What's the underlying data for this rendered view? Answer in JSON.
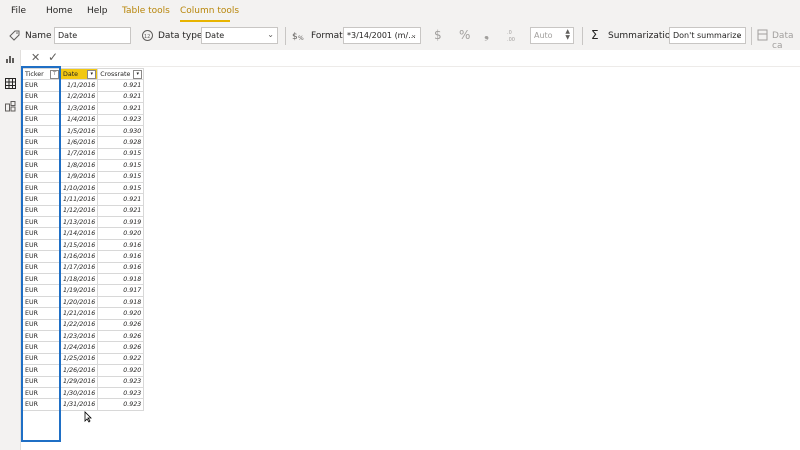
{
  "tabs": [
    {
      "label": "File"
    },
    {
      "label": "Home"
    },
    {
      "label": "Help"
    },
    {
      "label": "Table tools"
    },
    {
      "label": "Column tools"
    }
  ],
  "ribbon": {
    "name_label": "Name",
    "name_value": "Date",
    "datatype_label": "Data type",
    "datatype_value": "Date",
    "format_label": "Format",
    "format_value": "*3/14/2001 (m/...",
    "currency_symbol": "$",
    "percent_symbol": "%",
    "comma_symbol": "❟",
    "decimal_value": "Auto",
    "summarization_label": "Summarization",
    "summarization_value": "Don't summarize",
    "datacat_label": "Data ca"
  },
  "formula_bar": {
    "cancel": "✕",
    "commit": "✓"
  },
  "table": {
    "headers": [
      "Ticker",
      "Date",
      "Crossrate"
    ],
    "rows": [
      [
        "EUR",
        "1/1/2016",
        "0.921"
      ],
      [
        "EUR",
        "1/2/2016",
        "0.921"
      ],
      [
        "EUR",
        "1/3/2016",
        "0.921"
      ],
      [
        "EUR",
        "1/4/2016",
        "0.923"
      ],
      [
        "EUR",
        "1/5/2016",
        "0.930"
      ],
      [
        "EUR",
        "1/6/2016",
        "0.928"
      ],
      [
        "EUR",
        "1/7/2016",
        "0.915"
      ],
      [
        "EUR",
        "1/8/2016",
        "0.915"
      ],
      [
        "EUR",
        "1/9/2016",
        "0.915"
      ],
      [
        "EUR",
        "1/10/2016",
        "0.915"
      ],
      [
        "EUR",
        "1/11/2016",
        "0.921"
      ],
      [
        "EUR",
        "1/12/2016",
        "0.921"
      ],
      [
        "EUR",
        "1/13/2016",
        "0.919"
      ],
      [
        "EUR",
        "1/14/2016",
        "0.920"
      ],
      [
        "EUR",
        "1/15/2016",
        "0.916"
      ],
      [
        "EUR",
        "1/16/2016",
        "0.916"
      ],
      [
        "EUR",
        "1/17/2016",
        "0.916"
      ],
      [
        "EUR",
        "1/18/2016",
        "0.918"
      ],
      [
        "EUR",
        "1/19/2016",
        "0.917"
      ],
      [
        "EUR",
        "1/20/2016",
        "0.918"
      ],
      [
        "EUR",
        "1/21/2016",
        "0.920"
      ],
      [
        "EUR",
        "1/22/2016",
        "0.926"
      ],
      [
        "EUR",
        "1/23/2016",
        "0.926"
      ],
      [
        "EUR",
        "1/24/2016",
        "0.926"
      ],
      [
        "EUR",
        "1/25/2016",
        "0.922"
      ],
      [
        "EUR",
        "1/26/2016",
        "0.920"
      ],
      [
        "EUR",
        "1/29/2016",
        "0.923"
      ],
      [
        "EUR",
        "1/30/2016",
        "0.923"
      ],
      [
        "EUR",
        "1/31/2016",
        "0.923"
      ]
    ]
  },
  "colors": {
    "accent": "#f2c811",
    "highlight": "#1f6fc5"
  }
}
